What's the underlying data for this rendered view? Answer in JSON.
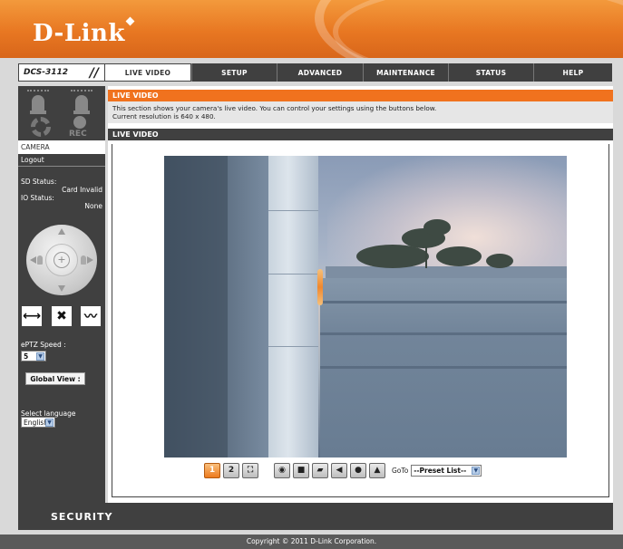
{
  "header": {
    "logo": "D-Link"
  },
  "nav": {
    "model": "DCS-3112",
    "tabs": [
      "LIVE VIDEO",
      "SETUP",
      "ADVANCED",
      "MAINTENANCE",
      "STATUS",
      "HELP"
    ],
    "active_tab": "LIVE VIDEO"
  },
  "sidebar": {
    "rec_label": "REC",
    "camera_link": "CAMERA",
    "logout": "Logout",
    "sd_status_label": "SD Status:",
    "sd_status_value": "Card Invalid",
    "io_status_label": "IO Status:",
    "io_status_value": "None",
    "eptz_speed_label": "ePTZ Speed :",
    "eptz_speed_value": "5",
    "global_view_button": "Global View :",
    "language_label": "Select language",
    "language_value": "English"
  },
  "main": {
    "section_title": "LIVE VIDEO",
    "description_line1": "This section shows your camera's live video. You can control your settings using the buttons below.",
    "description_line2": "Current resolution is 640 x 480.",
    "video_title": "LIVE VIDEO",
    "toolbar": {
      "goto_label": "GoTo",
      "preset_value": "--Preset List--",
      "buttons": [
        "stream-1-icon",
        "stream-2-icon",
        "fullscreen-icon",
        "snapshot-icon",
        "record-icon",
        "storage-folder-icon",
        "speaker-icon",
        "microphone-icon",
        "digital-output-icon"
      ]
    }
  },
  "footer": {
    "brand": "SECURITY",
    "copyright": "Copyright © 2011 D-Link Corporation."
  },
  "colors": {
    "accent": "#f0721e",
    "dark": "#404040"
  }
}
